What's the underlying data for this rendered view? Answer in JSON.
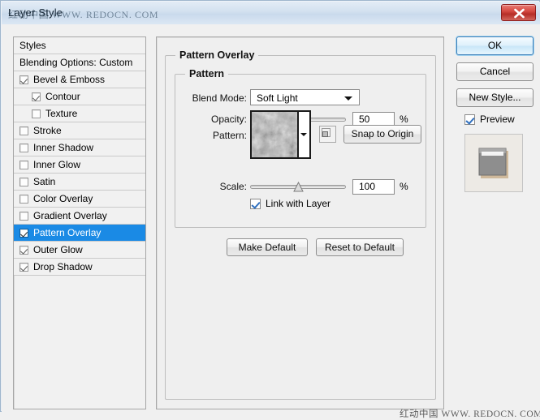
{
  "window": {
    "title": "Layer Style",
    "title_watermark": "红动中国 WWW. REDOCN. COM",
    "footer_watermark": "红动中国 WWW. REDOCN. COM",
    "close_label": "close-icon",
    "accent_color": "#1a8ae5",
    "close_color": "#c23b33"
  },
  "styles_panel": {
    "header": "Styles",
    "blending_options": "Blending Options: Custom",
    "items": [
      {
        "label": "Bevel & Emboss",
        "checked": true,
        "indent": false
      },
      {
        "label": "Contour",
        "checked": true,
        "indent": true
      },
      {
        "label": "Texture",
        "checked": false,
        "indent": true
      },
      {
        "label": "Stroke",
        "checked": false,
        "indent": false
      },
      {
        "label": "Inner Shadow",
        "checked": false,
        "indent": false
      },
      {
        "label": "Inner Glow",
        "checked": false,
        "indent": false
      },
      {
        "label": "Satin",
        "checked": false,
        "indent": false
      },
      {
        "label": "Color Overlay",
        "checked": false,
        "indent": false
      },
      {
        "label": "Gradient Overlay",
        "checked": false,
        "indent": false
      },
      {
        "label": "Pattern Overlay",
        "checked": true,
        "indent": false,
        "selected": true
      },
      {
        "label": "Outer Glow",
        "checked": true,
        "indent": false
      },
      {
        "label": "Drop Shadow",
        "checked": true,
        "indent": false
      }
    ]
  },
  "main": {
    "group_title": "Pattern Overlay",
    "subgroup_title": "Pattern",
    "blend_mode": {
      "label": "Blend Mode:",
      "value": "Soft Light"
    },
    "opacity": {
      "label": "Opacity:",
      "value": "50",
      "unit": "%",
      "percent": 50
    },
    "pattern": {
      "label": "Pattern:",
      "swatch_name": "clouds-texture"
    },
    "snap_to_origin": "Snap to Origin",
    "scale": {
      "label": "Scale:",
      "value": "100",
      "unit": "%",
      "percent": 50
    },
    "link_with_layer": {
      "label": "Link with Layer",
      "checked": true
    },
    "make_default": "Make Default",
    "reset_to_default": "Reset to Default"
  },
  "buttons": {
    "ok": "OK",
    "cancel": "Cancel",
    "new_style": "New Style...",
    "preview": {
      "label": "Preview",
      "checked": true
    }
  }
}
